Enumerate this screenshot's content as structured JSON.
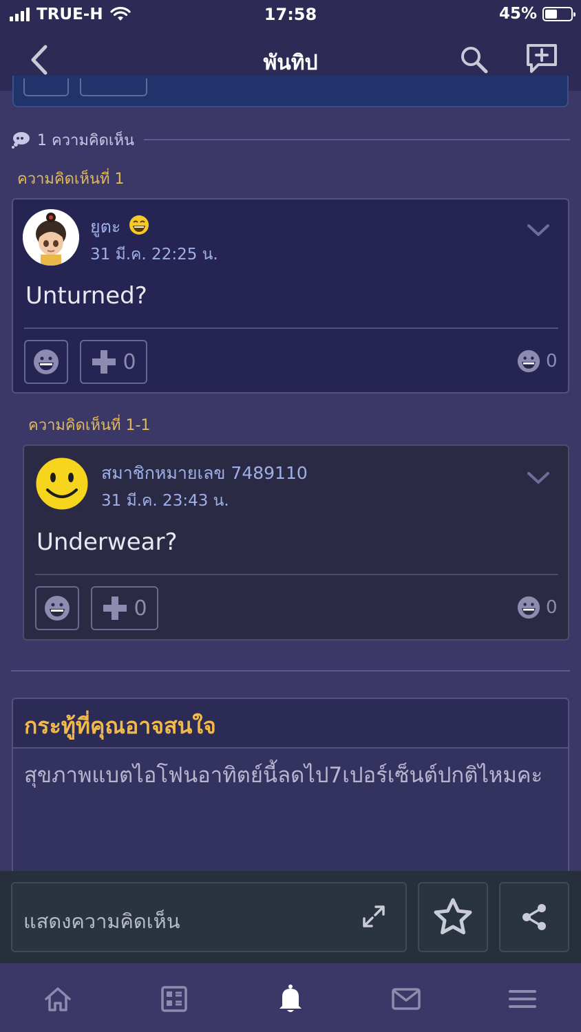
{
  "status_bar": {
    "carrier": "TRUE-H",
    "time": "17:58",
    "battery": "45%"
  },
  "nav": {
    "title": "พันทิป"
  },
  "comments_header": {
    "label": "1 ความคิดเห็น"
  },
  "comment1": {
    "number": "ความคิดเห็นที่ 1",
    "username": "ยูตะ",
    "time": "31 มี.ค. 22:25 น.",
    "text": "Unturned?",
    "plus_count": "0",
    "emotion_count": "0"
  },
  "reply1": {
    "number": "ความคิดเห็นที่ 1-1",
    "username": "สมาชิกหมายเลข 7489110",
    "time": "31 มี.ค. 23:43 น.",
    "text": "Underwear?",
    "plus_count": "0",
    "emotion_count": "0"
  },
  "suggest": {
    "title": "กระทู้ที่คุณอาจสนใจ",
    "item": "สุขภาพแบตไอโฟนอาทิตย์นี้ลดไป7เปอร์เซ็นต์ปกติไหมคะ"
  },
  "comment_input": {
    "placeholder": "แสดงความคิดเห็น"
  },
  "colors": {
    "nav_bg": "#2d2b55",
    "page_bg": "#3b3868",
    "accent_gold": "#f0b94a",
    "name_blue": "#9fb0e8"
  },
  "tabs": [
    "home-icon",
    "feed-icon",
    "notification-bell-icon",
    "mail-icon",
    "menu-icon"
  ]
}
